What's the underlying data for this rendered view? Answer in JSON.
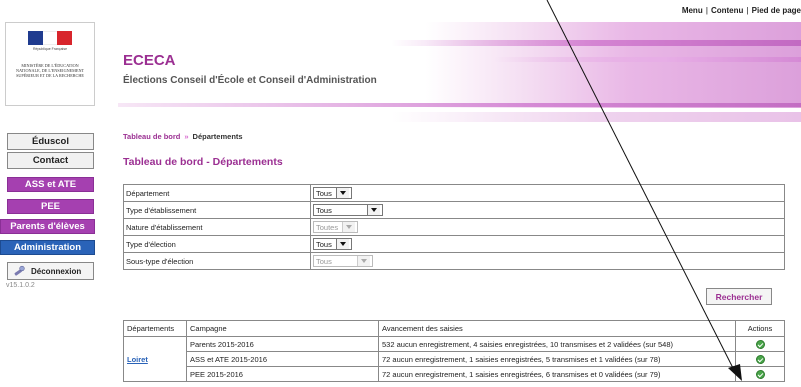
{
  "topnav": {
    "items": [
      "Menu",
      "Contenu",
      "Pied de page"
    ]
  },
  "logo": {
    "republic": "République Française",
    "ministry": "MINISTÈRE DE L'ÉDUCATION NATIONALE, DE L'ENSEIGNEMENT SUPÉRIEUR ET DE LA RECHERCHE"
  },
  "header": {
    "title": "ECECA",
    "subtitle": "Élections Conseil d'École et Conseil d'Administration"
  },
  "sidebar": {
    "items": [
      "Éduscol",
      "Contact",
      "ASS et ATE",
      "PEE",
      "Parents d'élèves",
      "Administration"
    ],
    "logout": "Déconnexion",
    "version": "v15.1.0.2"
  },
  "breadcrumb": {
    "home": "Tableau de bord",
    "current": "Départements"
  },
  "page": {
    "title": "Tableau de bord - Départements"
  },
  "filters": [
    {
      "label": "Département",
      "value": "Tous"
    },
    {
      "label": "Type d'établissement",
      "value": "Tous"
    },
    {
      "label": "Nature d'établissement",
      "value": "Toutes"
    },
    {
      "label": "Type d'élection",
      "value": "Tous"
    },
    {
      "label": "Sous-type d'élection",
      "value": "Tous"
    }
  ],
  "search": {
    "label": "Rechercher"
  },
  "results": {
    "headers": [
      "Départements",
      "Campagne",
      "Avancement des saisies",
      "Actions"
    ],
    "department": "Loiret",
    "rows": [
      {
        "campaign": "Parents 2015-2016",
        "progress": "532 aucun enregistrement, 4 saisies enregistrées, 10 transmises et 2 validées (sur 548)"
      },
      {
        "campaign": "ASS et ATE 2015-2016",
        "progress": "72 aucun enregistrement, 1 saisies enregistrées, 5 transmises et 1 validées (sur 78)"
      },
      {
        "campaign": "PEE 2015-2016",
        "progress": "72 aucun enregistrement, 1 saisies enregistrées, 6 transmises et 0 validées (sur 79)"
      }
    ]
  },
  "colors": {
    "brand": "#9b2f92",
    "purple_button": "#a540b0",
    "blue_button": "#2a63b8",
    "ok": "#4aa54a"
  }
}
